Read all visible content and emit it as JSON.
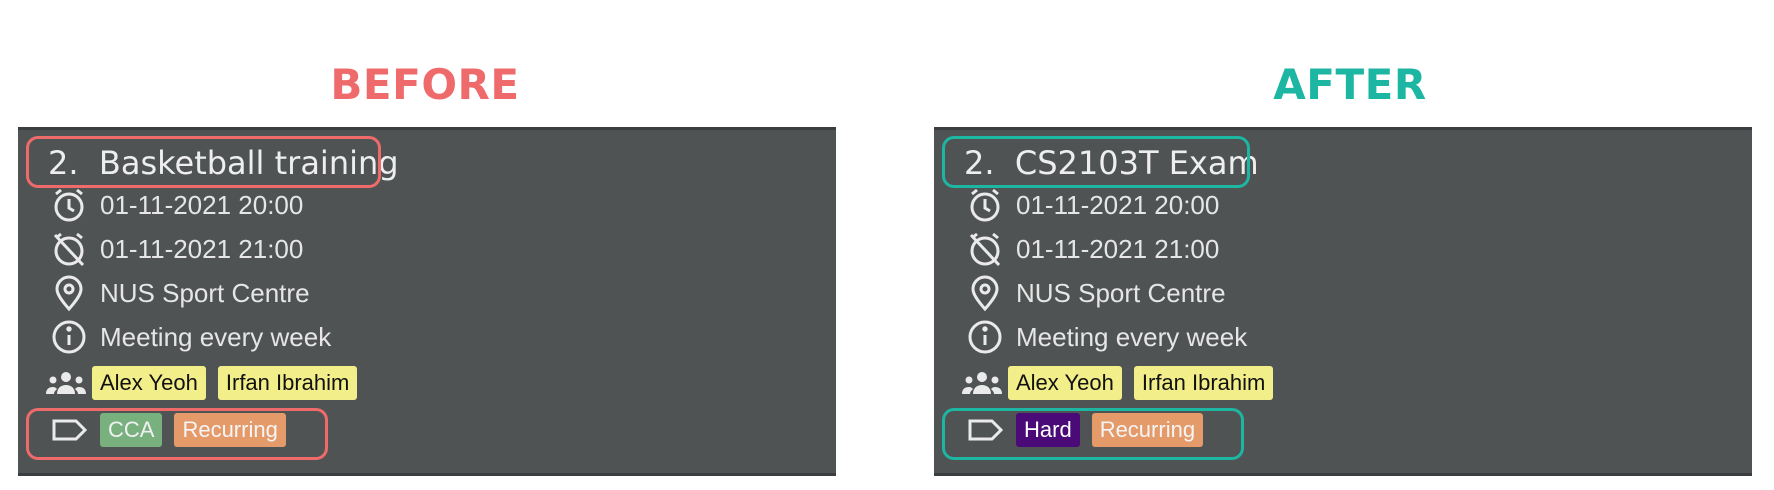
{
  "colors": {
    "before_accent": "#ef6b6b",
    "after_accent": "#1db6a3",
    "panel_bg": "#505354",
    "person_tag_bg": "#f2ef8a"
  },
  "before": {
    "heading": "BEFORE",
    "card": {
      "index": "2.",
      "title": "Basketball training",
      "start": "01-11-2021 20:00",
      "end": "01-11-2021 21:00",
      "location": "NUS Sport Centre",
      "description": "Meeting every week",
      "participants": [
        "Alex Yeoh",
        "Irfan Ibrahim"
      ],
      "tags": [
        {
          "label": "CCA",
          "color": "#78b07e",
          "text_color": "#f1f1f1"
        },
        {
          "label": "Recurring",
          "color": "#e59a6a",
          "text_color": "#f5f5f5"
        }
      ]
    }
  },
  "after": {
    "heading": "AFTER",
    "card": {
      "index": "2.",
      "title": "CS2103T Exam",
      "start": "01-11-2021 20:00",
      "end": "01-11-2021 21:00",
      "location": "NUS Sport Centre",
      "description": "Meeting every week",
      "participants": [
        "Alex Yeoh",
        "Irfan Ibrahim"
      ],
      "tags": [
        {
          "label": "Hard",
          "color": "#4a0b78",
          "text_color": "#ffffff"
        },
        {
          "label": "Recurring",
          "color": "#e59a6a",
          "text_color": "#f5f5f5"
        }
      ]
    }
  },
  "icons": {
    "start": "alarm-clock-icon",
    "end": "alarm-off-icon",
    "location": "map-pin-icon",
    "description": "info-icon",
    "participants": "people-group-icon",
    "tags": "tag-icon"
  }
}
